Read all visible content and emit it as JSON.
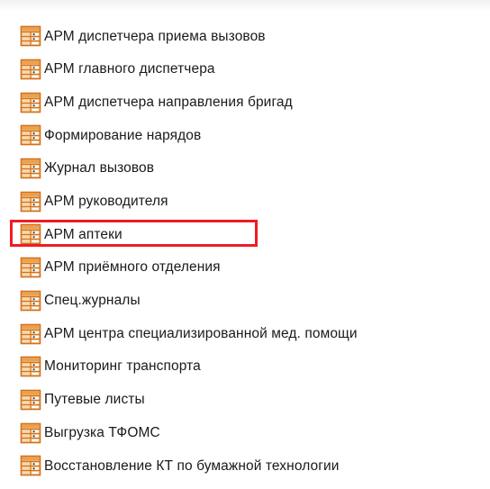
{
  "menu": {
    "highlight_color": "#ef1c24",
    "icon": "module-window-icon",
    "highlighted_index": 6,
    "items": [
      {
        "label": "АРМ диспетчера приема вызовов"
      },
      {
        "label": "АРМ главного диспетчера"
      },
      {
        "label": "АРМ диспетчера направления бригад"
      },
      {
        "label": "Формирование нарядов"
      },
      {
        "label": "Журнал вызовов"
      },
      {
        "label": "АРМ руководителя"
      },
      {
        "label": "АРМ аптеки"
      },
      {
        "label": "АРМ приёмного отделения"
      },
      {
        "label": "Спец.журналы"
      },
      {
        "label": "АРМ центра специализированной мед. помощи"
      },
      {
        "label": "Мониторинг транспорта"
      },
      {
        "label": "Путевые листы"
      },
      {
        "label": "Выгрузка ТФОМС"
      },
      {
        "label": "Восстановление КТ по бумажной технологии"
      }
    ]
  }
}
